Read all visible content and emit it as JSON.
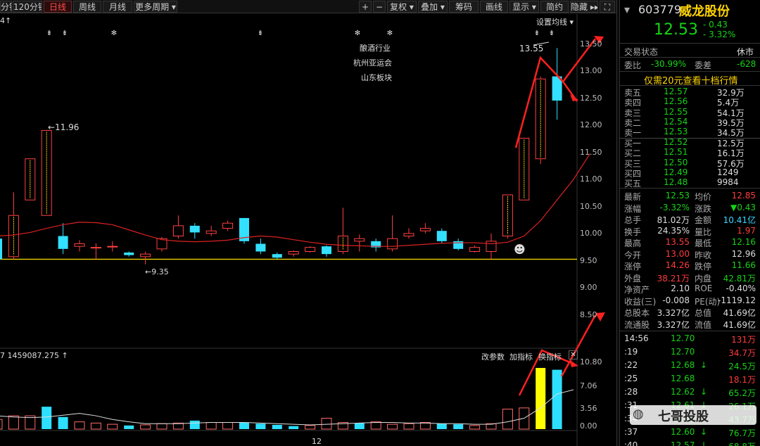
{
  "toolbar": {
    "items": [
      {
        "label": "分钟",
        "active": false
      },
      {
        "label": "120分钟",
        "active": false
      },
      {
        "label": "日线",
        "active": true
      },
      {
        "label": "周线",
        "active": false
      },
      {
        "label": "月线",
        "active": false
      },
      {
        "label": "更多周期 ▾",
        "active": false
      },
      {
        "label": "+",
        "active": false
      },
      {
        "label": "−",
        "active": false
      },
      {
        "label": "复权 ▾",
        "active": false
      },
      {
        "label": "叠加 ▾",
        "active": false
      },
      {
        "label": "筹码",
        "active": false
      },
      {
        "label": "画线",
        "active": false
      },
      {
        "label": "显示 ▾",
        "active": false
      },
      {
        "label": "简约",
        "active": false
      },
      {
        "label": "隐藏 ▸▸",
        "active": false
      },
      {
        "label": "⛶",
        "active": false
      }
    ]
  },
  "main_chart": {
    "top_left_label": "4↑",
    "settings_label": "设置均线 ▾",
    "annotations": [
      "酿酒行业",
      "杭州亚运会",
      "山东板块"
    ],
    "marker_glyphs": [
      "⇟",
      "⇟",
      "✻",
      "⇟",
      "✻",
      "✻",
      "⇟",
      "⇟"
    ],
    "high_label": "13.55",
    "peak_label": "←11.96",
    "low_label": "←9.35",
    "y_ticks": [
      "13.50",
      "13.00",
      "12.50",
      "12.00",
      "11.50",
      "11.00",
      "10.50",
      "10.00",
      "9.50",
      "9.00",
      "8.50"
    ],
    "smiley": "☻"
  },
  "volume_panel": {
    "label": "7 1459087.275 ↑",
    "buttons": [
      "改参数",
      "加指标",
      "换指标"
    ],
    "close": "✕",
    "y_ticks": [
      "10.80",
      "7.06",
      "3.56",
      "0.00"
    ],
    "x_label": "12"
  },
  "chart_data": {
    "type": "candlestick",
    "price": {
      "ylim": [
        8.2,
        13.8
      ],
      "reference_line": 9.45,
      "candles": [
        {
          "o": 9.85,
          "c": 9.45,
          "h": 10.0,
          "l": 9.4
        },
        {
          "o": 9.5,
          "c": 10.3,
          "h": 10.75,
          "l": 9.45
        },
        {
          "o": 10.6,
          "c": 11.4,
          "h": 11.4,
          "l": 10.6
        },
        {
          "o": 10.3,
          "c": 11.95,
          "h": 11.96,
          "l": 10.3
        },
        {
          "o": 9.9,
          "c": 9.65,
          "h": 10.15,
          "l": 9.55
        },
        {
          "o": 9.7,
          "c": 9.75,
          "h": 9.82,
          "l": 9.6
        },
        {
          "o": 9.68,
          "c": 9.68,
          "h": 9.76,
          "l": 9.45
        },
        {
          "o": 9.7,
          "c": 9.7,
          "h": 9.8,
          "l": 9.6
        },
        {
          "o": 9.58,
          "c": 9.53,
          "h": 9.6,
          "l": 9.5
        },
        {
          "o": 9.5,
          "c": 9.55,
          "h": 9.6,
          "l": 9.35
        },
        {
          "o": 9.65,
          "c": 9.85,
          "h": 9.88,
          "l": 9.6
        },
        {
          "o": 9.9,
          "c": 10.1,
          "h": 10.3,
          "l": 9.85
        },
        {
          "o": 10.1,
          "c": 9.97,
          "h": 10.15,
          "l": 9.85
        },
        {
          "o": 9.95,
          "c": 10.0,
          "h": 10.1,
          "l": 9.9
        },
        {
          "o": 10.05,
          "c": 10.15,
          "h": 10.2,
          "l": 10.0
        },
        {
          "o": 10.25,
          "c": 9.8,
          "h": 10.25,
          "l": 9.75
        },
        {
          "o": 9.75,
          "c": 9.6,
          "h": 9.85,
          "l": 9.55
        },
        {
          "o": 9.55,
          "c": 9.48,
          "h": 9.58,
          "l": 9.45
        },
        {
          "o": 9.55,
          "c": 9.6,
          "h": 9.62,
          "l": 9.5
        },
        {
          "o": 9.6,
          "c": 9.68,
          "h": 9.7,
          "l": 9.58
        },
        {
          "o": 9.7,
          "c": 9.55,
          "h": 9.72,
          "l": 9.5
        },
        {
          "o": 9.6,
          "c": 9.9,
          "h": 10.45,
          "l": 9.55
        },
        {
          "o": 9.8,
          "c": 9.85,
          "h": 9.93,
          "l": 9.6
        },
        {
          "o": 9.8,
          "c": 9.68,
          "h": 9.85,
          "l": 9.6
        },
        {
          "o": 9.65,
          "c": 9.85,
          "h": 10.3,
          "l": 9.6
        },
        {
          "o": 9.9,
          "c": 9.95,
          "h": 10.05,
          "l": 9.85
        },
        {
          "o": 10.0,
          "c": 10.05,
          "h": 10.15,
          "l": 9.95
        },
        {
          "o": 10.0,
          "c": 9.8,
          "h": 10.05,
          "l": 9.75
        },
        {
          "o": 9.8,
          "c": 9.65,
          "h": 9.85,
          "l": 9.62
        },
        {
          "o": 9.6,
          "c": 9.68,
          "h": 9.72,
          "l": 9.58
        },
        {
          "o": 9.6,
          "c": 9.8,
          "h": 9.95,
          "l": 9.45
        },
        {
          "o": 9.9,
          "c": 10.7,
          "h": 10.7,
          "l": 9.85
        },
        {
          "o": 10.6,
          "c": 11.8,
          "h": 11.8,
          "l": 10.6
        },
        {
          "o": 11.4,
          "c": 12.95,
          "h": 13.0,
          "l": 11.3
        },
        {
          "o": 13.0,
          "c": 12.53,
          "h": 13.55,
          "l": 12.16
        }
      ],
      "ma": [
        9.9,
        9.92,
        9.97,
        10.05,
        10.12,
        10.17,
        10.16,
        10.12,
        10.02,
        9.92,
        9.83,
        9.8,
        9.79,
        9.8,
        9.82,
        9.87,
        9.9,
        9.88,
        9.83,
        9.78,
        9.74,
        9.72,
        9.71,
        9.7,
        9.7,
        9.72,
        9.74,
        9.76,
        9.77,
        9.77,
        9.75,
        9.78,
        9.9,
        10.2,
        10.6,
        11.0,
        11.5
      ]
    },
    "volume": {
      "ylim": [
        0,
        10.8
      ],
      "bars": [
        1.6,
        2.2,
        2.2,
        3.7,
        2.0,
        1.2,
        1.0,
        0.8,
        0.6,
        0.7,
        0.9,
        1.0,
        1.4,
        1.1,
        1.1,
        1.1,
        0.9,
        0.7,
        0.5,
        0.6,
        1.8,
        1.1,
        1.0,
        1.2,
        0.8,
        0.9,
        1.1,
        0.9,
        0.8,
        0.6,
        0.9,
        3.3,
        3.5,
        10.1,
        9.8
      ],
      "colors": [
        "red",
        "red",
        "red",
        "cyan",
        "cyan",
        "red",
        "red",
        "red",
        "cyan",
        "red",
        "red",
        "red",
        "cyan",
        "red",
        "red",
        "cyan",
        "cyan",
        "cyan",
        "cyan",
        "red",
        "red",
        "red",
        "cyan",
        "red",
        "red",
        "red",
        "red",
        "cyan",
        "cyan",
        "red",
        "red",
        "red",
        "red",
        "yellow",
        "cyan"
      ],
      "ma": [
        2.2,
        2.0,
        1.9,
        2.0,
        2.3,
        2.6,
        2.2,
        1.6,
        1.2,
        0.9,
        0.9,
        0.9,
        1.0,
        1.1,
        1.1,
        1.1,
        1.0,
        0.9,
        0.8,
        0.7,
        0.8,
        0.9,
        1.0,
        1.1,
        1.1,
        1.0,
        1.0,
        0.9,
        0.9,
        0.8,
        0.8,
        1.2,
        1.8,
        3.5,
        5.8,
        6.5
      ]
    }
  },
  "quote": {
    "code": "603779",
    "name": "威龙股份",
    "price": "12.53",
    "change": "- 0.43",
    "change_pct": "- 3.32%",
    "status_label": "交易状态",
    "status_value": "休市",
    "weibi_label": "委比",
    "weibi": "-30.99%",
    "weicha_label": "委差",
    "weicha": "-628",
    "banner": "仅需20元查看十档行情",
    "sells": [
      {
        "label": "卖五",
        "price": "12.57",
        "vol": "32.9万"
      },
      {
        "label": "卖四",
        "price": "12.56",
        "vol": "5.4万"
      },
      {
        "label": "卖三",
        "price": "12.55",
        "vol": "54.1万"
      },
      {
        "label": "卖二",
        "price": "12.54",
        "vol": "39.5万"
      },
      {
        "label": "卖一",
        "price": "12.53",
        "vol": "34.5万"
      }
    ],
    "buys": [
      {
        "label": "买一",
        "price": "12.52",
        "vol": "12.5万"
      },
      {
        "label": "买二",
        "price": "12.51",
        "vol": "16.1万"
      },
      {
        "label": "买三",
        "price": "12.50",
        "vol": "57.6万"
      },
      {
        "label": "买四",
        "price": "12.49",
        "vol": "1249"
      },
      {
        "label": "买五",
        "price": "12.48",
        "vol": "9984"
      }
    ],
    "stats": [
      {
        "l1": "最新",
        "v1": "12.53",
        "c1": "green",
        "l2": "均价",
        "v2": "12.85",
        "c2": "red"
      },
      {
        "l1": "涨幅",
        "v1": "-3.32%",
        "c1": "green",
        "l2": "涨跌",
        "v2": "▼0.43",
        "c2": "green"
      },
      {
        "l1": "总手",
        "v1": "81.02万",
        "c1": "white",
        "l2": "金额",
        "v2": "10.41亿",
        "c2": "cyan"
      },
      {
        "l1": "换手",
        "v1": "24.35%",
        "c1": "white",
        "l2": "量比",
        "v2": "1.97",
        "c2": "red"
      },
      {
        "l1": "最高",
        "v1": "13.55",
        "c1": "red",
        "l2": "最低",
        "v2": "12.16",
        "c2": "green"
      },
      {
        "l1": "今开",
        "v1": "13.00",
        "c1": "red",
        "l2": "昨收",
        "v2": "12.96",
        "c2": "white"
      },
      {
        "l1": "涨停",
        "v1": "14.26",
        "c1": "red",
        "l2": "跌停",
        "v2": "11.66",
        "c2": "green"
      },
      {
        "l1": "外盘",
        "v1": "38.21万",
        "c1": "red",
        "l2": "内盘",
        "v2": "42.81万",
        "c2": "green"
      },
      {
        "l1": "净资产",
        "v1": "2.10",
        "c1": "white",
        "l2": "ROE",
        "v2": "-0.40%",
        "c2": "white"
      },
      {
        "l1": "收益(三)",
        "v1": "-0.008",
        "c1": "white",
        "l2": "PE(动)",
        "v2": "-1119.12",
        "c2": "white"
      },
      {
        "l1": "总股本",
        "v1": "3.327亿",
        "c1": "white",
        "l2": "总值",
        "v2": "41.69亿",
        "c2": "white"
      },
      {
        "l1": "流通股",
        "v1": "3.327亿",
        "c1": "white",
        "l2": "流值",
        "v2": "41.69亿",
        "c2": "white"
      }
    ],
    "ticks": [
      {
        "t": "14:56",
        "p": "12.70",
        "pc": "green",
        "arrow": "",
        "v": "131万",
        "vc": "red"
      },
      {
        "t": ":19",
        "p": "12.70",
        "pc": "green",
        "arrow": "",
        "v": "34.7万",
        "vc": "red"
      },
      {
        "t": ":22",
        "p": "12.68",
        "pc": "green",
        "arrow": "↓",
        "v": "24.5万",
        "vc": "green"
      },
      {
        "t": ":25",
        "p": "12.68",
        "pc": "green",
        "arrow": "",
        "v": "18.1万",
        "vc": "red"
      },
      {
        "t": ":28",
        "p": "12.62",
        "pc": "green",
        "arrow": "↓",
        "v": "65.2万",
        "vc": "green"
      },
      {
        "t": ":31",
        "p": "12.61",
        "pc": "green",
        "arrow": "↓",
        "v": "26.1万",
        "vc": "green"
      },
      {
        "t": ":34",
        "p": "12.60",
        "pc": "green",
        "arrow": "↓",
        "v": "43.7万",
        "vc": "green"
      },
      {
        "t": ":37",
        "p": "12.60",
        "pc": "green",
        "arrow": "↓",
        "v": "76.7万",
        "vc": "green"
      },
      {
        "t": ":40",
        "p": "12.57",
        "pc": "green",
        "arrow": "↓",
        "v": "68.8万",
        "vc": "green"
      }
    ],
    "watermark": "七哥投股"
  }
}
